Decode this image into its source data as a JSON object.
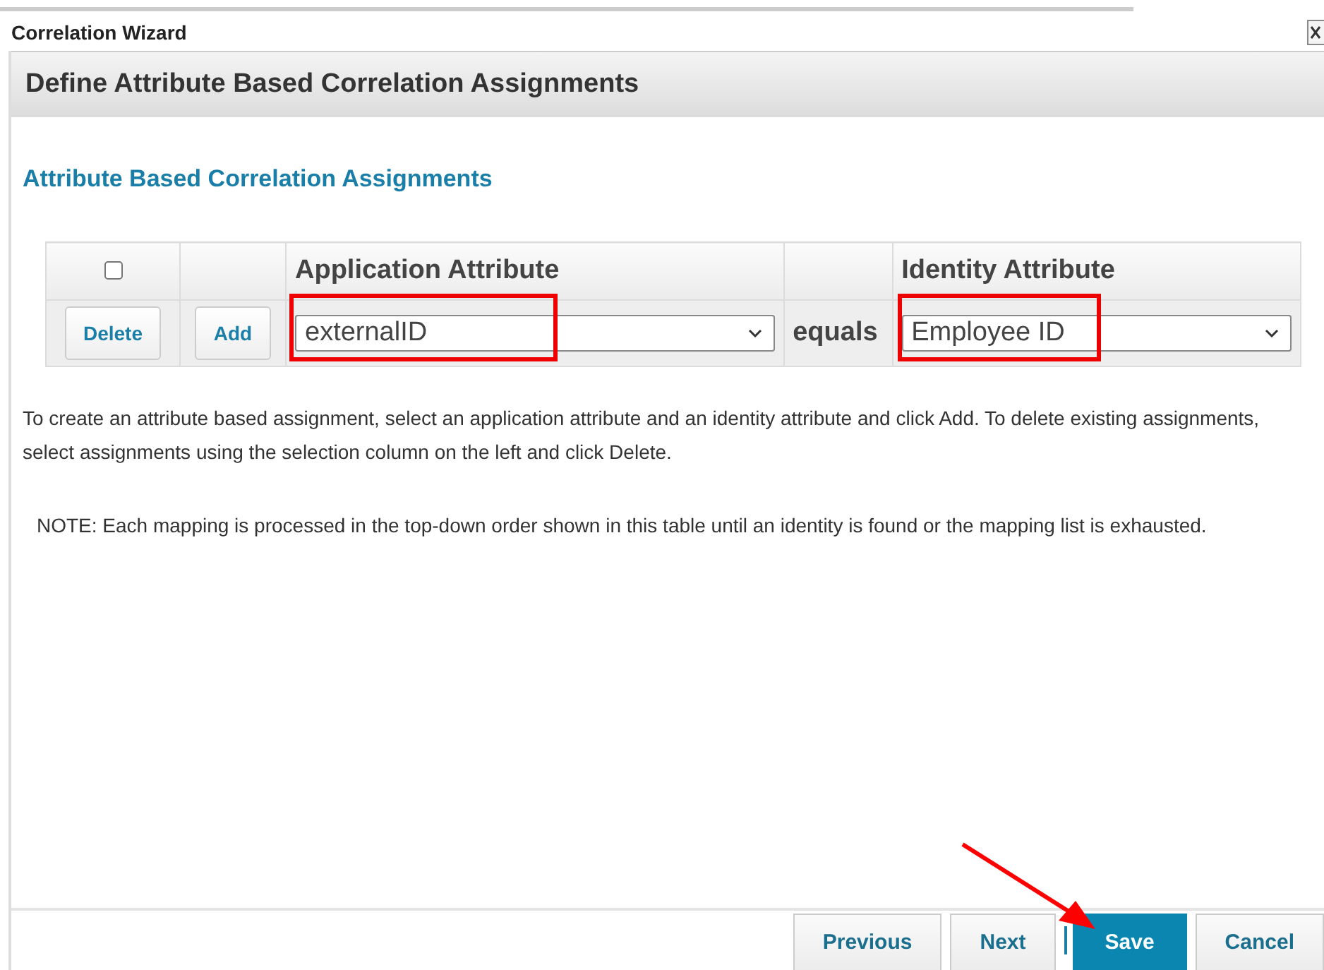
{
  "window": {
    "title": "Correlation Wizard"
  },
  "header": {
    "title": "Define Attribute Based Correlation Assignments"
  },
  "section": {
    "title": "Attribute Based Correlation Assignments"
  },
  "table": {
    "select_all": {
      "checked": false
    },
    "columns": [
      "Application Attribute",
      "Identity Attribute"
    ],
    "row": {
      "buttons": [
        "Delete",
        "Add"
      ],
      "application_attribute": "externalID",
      "operator": "equals",
      "identity_attribute": "Employee ID"
    }
  },
  "help_text": "To create an attribute based assignment, select an application attribute and an identity attribute and click Add. To delete existing assignments, select assignments using the selection column on the left and click Delete.",
  "note": "NOTE: Each mapping is processed in the top-down order shown in this table until an identity is found or the mapping list is exhausted.",
  "footer": {
    "buttons": [
      {
        "label": "Previous",
        "selected": false
      },
      {
        "label": "Next",
        "selected": false
      },
      {
        "label": "Save",
        "selected": true
      },
      {
        "label": "Cancel",
        "selected": false
      }
    ]
  }
}
